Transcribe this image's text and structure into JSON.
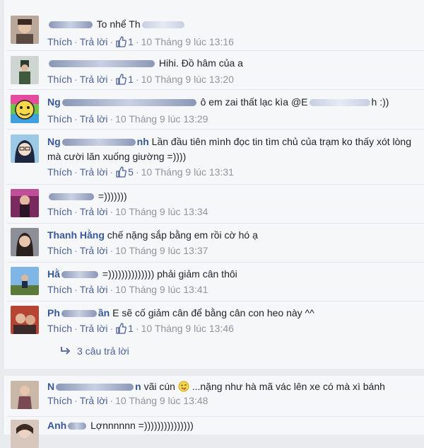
{
  "actions": {
    "like": "Thích",
    "reply": "Trả lời",
    "sep": "·"
  },
  "comments": [
    {
      "author_visible": "",
      "text": "To nhể Th",
      "likes": "1",
      "time": "10 Tháng 9 lúc 13:16",
      "avatar": "person-photo"
    },
    {
      "author_visible": "",
      "text": "Hihi. Đồ hâm của a",
      "likes": "1",
      "time": "10 Tháng 9 lúc 13:20",
      "avatar": "person-photo"
    },
    {
      "author_visible": "Ng",
      "text": "ô em zai thất lạc kìa @E",
      "text_tail": "h :))",
      "likes": "",
      "time": "10 Tháng 9 lúc 13:29",
      "avatar": "cartoon-face"
    },
    {
      "author_visible": "Ng",
      "author_tail": "nh",
      "text": "Lần đầu tiên mình đọc tin tìm chủ của trạm ko thấy xót lòng mà cười lăn xuống giường =))))",
      "likes": "5",
      "time": "10 Tháng 9 lúc 13:31",
      "avatar": "anime-girl"
    },
    {
      "author_visible": "",
      "text": "=)))))))",
      "likes": "",
      "time": "10 Tháng 9 lúc 13:34",
      "avatar": "person-photo"
    },
    {
      "author_visible": "Thanh Hằng",
      "text": "chế nặng sắp bằng em rồi cờ hó ạ",
      "likes": "",
      "time": "10 Tháng 9 lúc 13:37",
      "avatar": "person-photo"
    },
    {
      "author_visible": "Hằ",
      "text": "=)))))))))))))) phải giảm cân thôi",
      "likes": "",
      "time": "10 Tháng 9 lúc 13:41",
      "avatar": "landscape-photo"
    },
    {
      "author_visible": "Ph",
      "author_tail": "ần",
      "text": "E sẽ cố giảm cân để bằng cân con heo này ^^",
      "likes": "1",
      "time": "10 Tháng 9 lúc 13:46",
      "avatar": "person-photo"
    },
    {
      "author_visible": "N",
      "author_tail": "n",
      "text": "vãi cún",
      "text_tail": "...nặng như hà mã vác lên xe có mà xì bánh",
      "likes": "",
      "time": "10 Tháng 9 lúc 13:48",
      "avatar": "person-photo"
    },
    {
      "author_visible": "Anh",
      "text": "Lợnnnnnn =)))))))))))))))",
      "likes": "",
      "time": "",
      "avatar": "person-photo"
    }
  ],
  "replies_label": "3 câu trả lời",
  "colors": {
    "link": "#365899",
    "meta": "#90949c",
    "bg": "#f6f7f9"
  }
}
